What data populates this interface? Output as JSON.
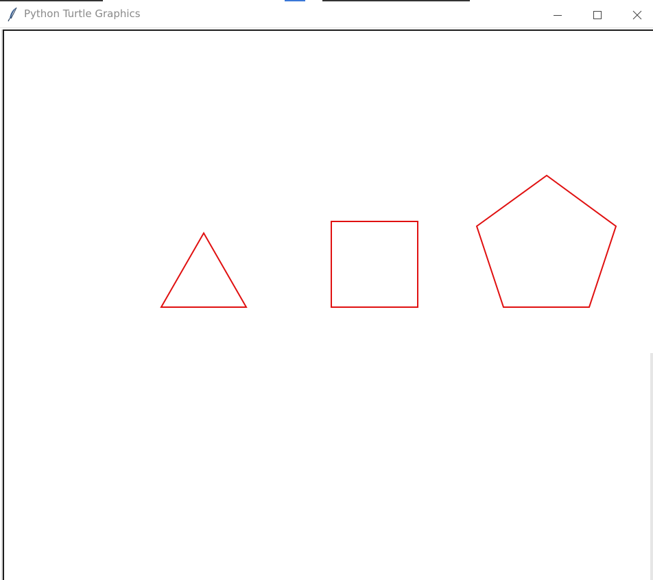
{
  "window": {
    "title": "Python Turtle Graphics",
    "app_icon": "feather-icon",
    "controls": {
      "minimize": "minimize-icon",
      "maximize": "maximize-icon",
      "close": "close-icon"
    }
  },
  "canvas": {
    "background": "#ffffff",
    "pen_color": "#e01010",
    "shapes": [
      {
        "name": "triangle",
        "sides": 3
      },
      {
        "name": "square",
        "sides": 4
      },
      {
        "name": "pentagon",
        "sides": 5
      }
    ]
  }
}
